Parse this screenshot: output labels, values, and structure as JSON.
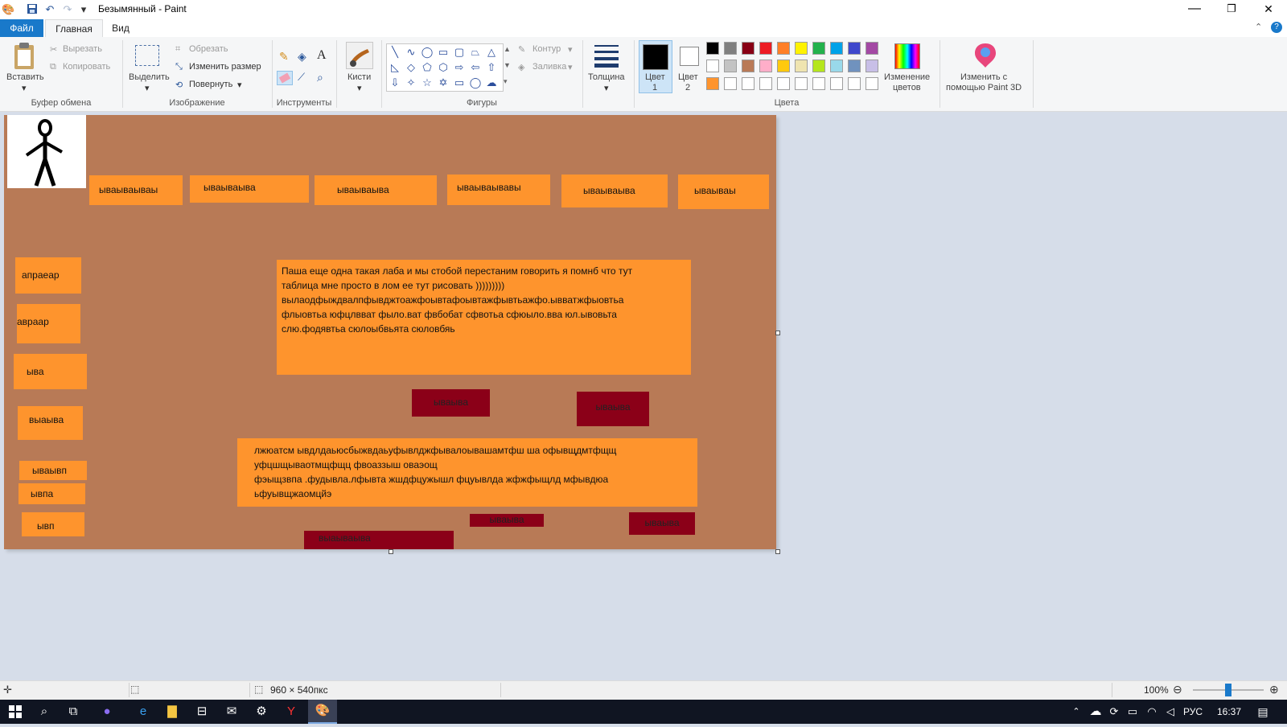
{
  "window": {
    "title": "Безымянный - Paint",
    "minimize": "—",
    "restore": "❐",
    "close": "✕"
  },
  "quick_access": {
    "save_icon": "floppy-icon",
    "undo_icon": "undo-icon",
    "redo_icon": "redo-icon"
  },
  "tabs": [
    "Файл",
    "Главная",
    "Вид"
  ],
  "ribbon": {
    "clipboard": {
      "paste": "Вставить",
      "cut": "Вырезать",
      "copy": "Копировать",
      "label": "Буфер обмена"
    },
    "image": {
      "select": "Выделить",
      "crop": "Обрезать",
      "resize": "Изменить размер",
      "rotate": "Повернуть",
      "label": "Изображение"
    },
    "tools": {
      "label": "Инструменты"
    },
    "brushes": {
      "label": "Кисти"
    },
    "shapes": {
      "outline": "Контур",
      "fill": "Заливка",
      "label": "Фигуры"
    },
    "thickness": {
      "label": "Толщина"
    },
    "colors": {
      "color1": "Цвет",
      "color1_num": "1",
      "color2": "Цвет",
      "color2_num": "2",
      "edit": "Изменение",
      "edit2": "цветов",
      "label": "Цвета",
      "palette_row1": [
        "#000000",
        "#7f7f7f",
        "#880015",
        "#ed1c24",
        "#ff7f27",
        "#fff200",
        "#22b14c",
        "#00a2e8",
        "#3f48cc",
        "#a349a4"
      ],
      "palette_row2": [
        "#ffffff",
        "#c3c3c3",
        "#b97a57",
        "#ffaec9",
        "#ffc90e",
        "#efe4b0",
        "#b5e61d",
        "#99d9ea",
        "#7092be",
        "#c8bfe7"
      ],
      "palette_row3": [
        "#fe942d",
        "#ffffff",
        "#ffffff",
        "#ffffff",
        "#ffffff",
        "#ffffff",
        "#ffffff",
        "#ffffff",
        "#ffffff",
        "#ffffff"
      ]
    },
    "paint3d": {
      "line1": "Изменить с",
      "line2": "помощью Paint 3D"
    }
  },
  "canvas": {
    "top_boxes": [
      "ываываываы",
      "ываываыва",
      "ываываыва",
      "ываываывавы",
      "ываываыва",
      "ываываы"
    ],
    "left_boxes": [
      "апраеар",
      "авраар",
      "ыва",
      "выаыва",
      "ываывп",
      "ывпа",
      "ывп"
    ],
    "big_text_1": [
      "Паша еще одна такая лаба и мы стобой перестаним говорить я помнб что тут",
      "таблица мне просто в лом ее тут рисовать )))))))))",
      "вылаодфыждвалпфывджтоажфоывтафоывтажфывтьажфо.ывватжфыовтьа",
      "флыовтьа юфцлвват фыло.ват фвбобат сфвотьа сфюыло.вва юл.ывовьта",
      "слю.фодявтьа сюлоыбвьята сюловбяь"
    ],
    "dark_boxes": [
      "ываыва",
      "ываыва",
      "ываыва",
      "ываыва",
      "выаываыва"
    ],
    "big_text_2": [
      "лжюатсм ывдлдаьюсбыжвдаьуфывлджфывалоывашамтфш ша офывщдмтфщщ",
      "уфцшщываотмщфщц фвоаззыш оваэощ",
      "фэыщзвпа .фудывла.лфывта жшдфцужышл фцуывлда жфжфыщлд мфывдюа",
      "ьфуывщжаомцйэ"
    ]
  },
  "statusbar": {
    "dimensions": "960 × 540пкс",
    "zoom": "100%",
    "zoom_level": 0.5
  },
  "taskbar": {
    "lang": "РУС",
    "time": "16:37"
  }
}
